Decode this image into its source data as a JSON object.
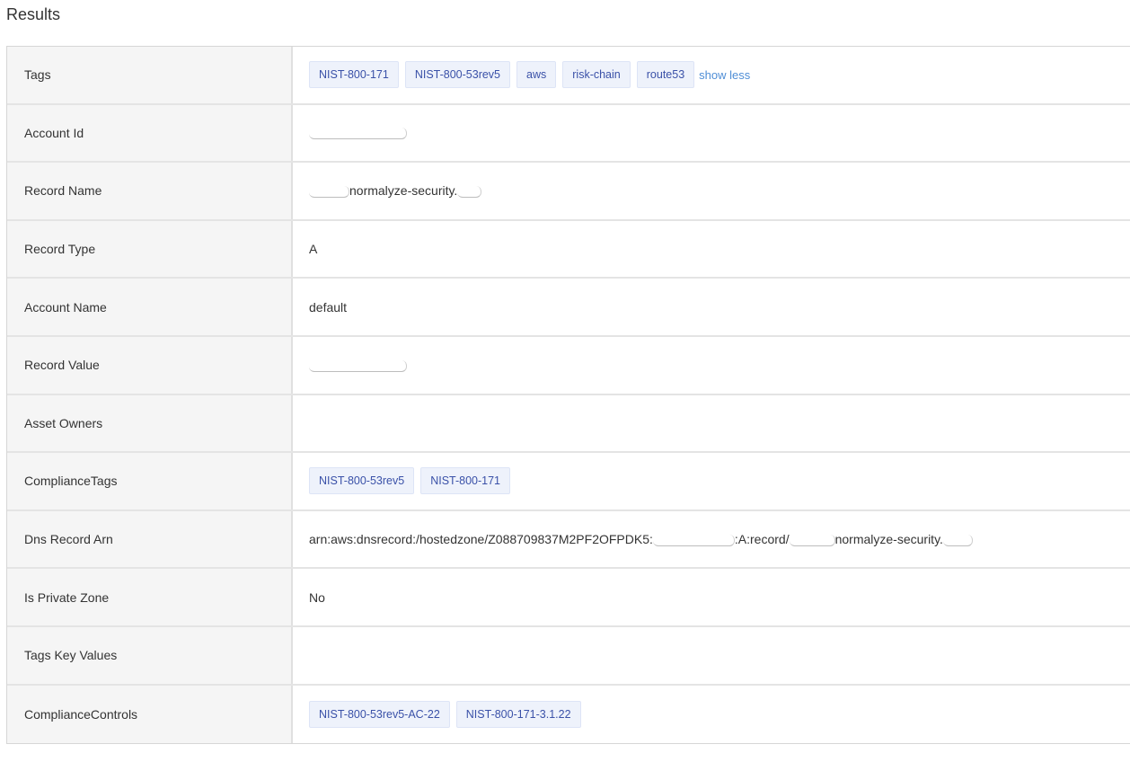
{
  "title": "Results",
  "rows": [
    {
      "key": "Tags",
      "type": "tags",
      "tags": [
        "NIST-800-171",
        "NIST-800-53rev5",
        "aws",
        "risk-chain",
        "route53"
      ],
      "link": "show less"
    },
    {
      "key": "Account Id",
      "type": "redacted-text",
      "before": "",
      "after": ""
    },
    {
      "key": "Record Name",
      "type": "redacted-text",
      "before": "",
      "after": "normalyze-security."
    },
    {
      "key": "Record Type",
      "type": "text",
      "value": "A"
    },
    {
      "key": "Account Name",
      "type": "text",
      "value": "default"
    },
    {
      "key": "Record Value",
      "type": "redacted-text",
      "before": "",
      "after": ""
    },
    {
      "key": "Asset Owners",
      "type": "text",
      "value": ""
    },
    {
      "key": "ComplianceTags",
      "type": "tags",
      "tags": [
        "NIST-800-53rev5",
        "NIST-800-171"
      ]
    },
    {
      "key": "Dns Record Arn",
      "type": "arn",
      "part1": "arn:aws:dnsrecord:/hostedzone/Z088709837M2PF2OFPDK5:",
      "part2": ":A:record/",
      "part3": "normalyze-security."
    },
    {
      "key": "Is Private Zone",
      "type": "text",
      "value": "No"
    },
    {
      "key": "Tags Key Values",
      "type": "text",
      "value": ""
    },
    {
      "key": "ComplianceControls",
      "type": "tags",
      "tags": [
        "NIST-800-53rev5-AC-22",
        "NIST-800-171-3.1.22"
      ]
    }
  ]
}
